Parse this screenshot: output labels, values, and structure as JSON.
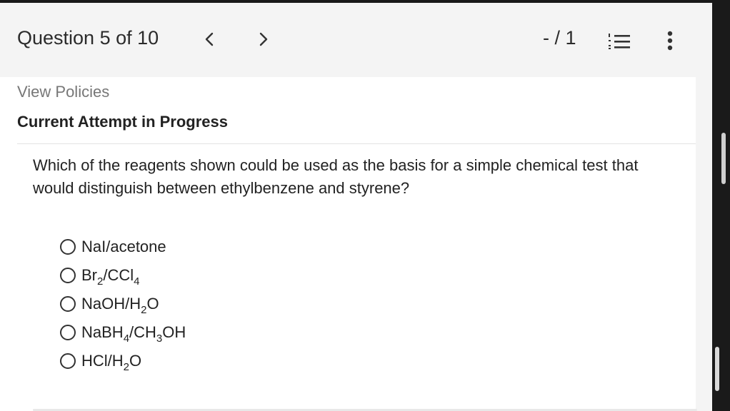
{
  "header": {
    "question_counter": "Question 5 of 10",
    "prev_icon": "chevron-left-icon",
    "next_icon": "chevron-right-icon",
    "score": "- / 1",
    "list_icon": "numbered-list-icon",
    "more_icon": "vertical-ellipsis-icon"
  },
  "content": {
    "view_policies": "View Policies",
    "attempt_status": "Current Attempt in Progress",
    "question_text": "Which of the reagents shown could be used as the basis for a simple chemical test that would distinguish between ethylbenzene and styrene?",
    "options": [
      {
        "parts": [
          "NaI/acetone"
        ]
      },
      {
        "parts": [
          "Br",
          "2",
          "/CCl",
          "4"
        ]
      },
      {
        "parts": [
          "NaOH/H",
          "2",
          "O"
        ]
      },
      {
        "parts": [
          "NaBH",
          "4",
          "/CH",
          "3",
          "OH"
        ]
      },
      {
        "parts": [
          "HCl/H",
          "2",
          "O"
        ]
      }
    ]
  },
  "colors": {
    "header_bg": "#f4f4f4",
    "content_bg": "#ffffff",
    "text": "#222222",
    "muted": "#777777",
    "bezel": "#1a1a1a"
  }
}
